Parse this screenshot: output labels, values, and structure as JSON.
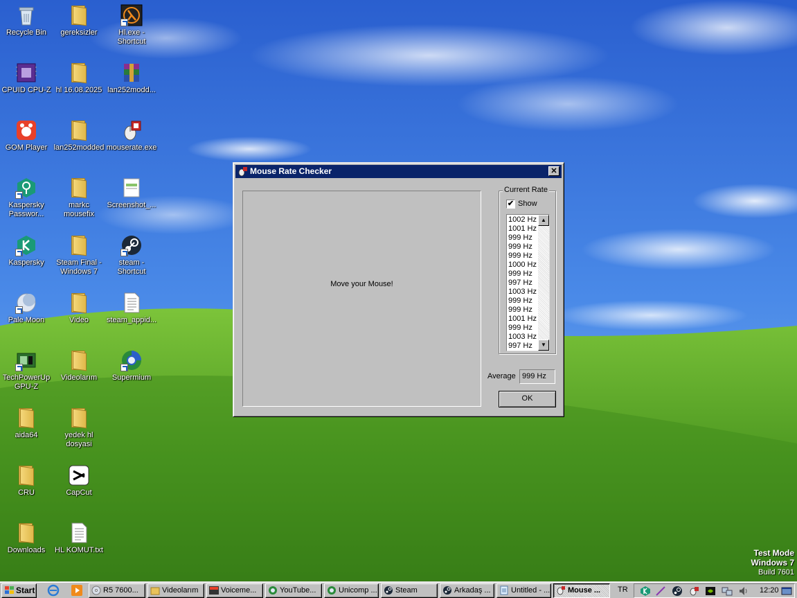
{
  "desktop": {
    "icons": [
      {
        "label": "Recycle Bin",
        "kind": "recycle-bin"
      },
      {
        "label": "gereksizler",
        "kind": "folder"
      },
      {
        "label": "Hl.exe - Shortcut",
        "kind": "half-life-shortcut"
      },
      {
        "label": "CPUID CPU-Z",
        "kind": "cpuz"
      },
      {
        "label": "hl 16.08.2025",
        "kind": "folder"
      },
      {
        "label": "lan252modd...",
        "kind": "winrar-archive"
      },
      {
        "label": "GOM Player",
        "kind": "gom-player"
      },
      {
        "label": "lan252modded",
        "kind": "folder"
      },
      {
        "label": "mouserate.exe",
        "kind": "mouserate"
      },
      {
        "label": "Kaspersky Passwor...",
        "kind": "kaspersky-password-shortcut"
      },
      {
        "label": "markc mousefix",
        "kind": "folder"
      },
      {
        "label": "Screenshot_...",
        "kind": "image-file"
      },
      {
        "label": "Kaspersky",
        "kind": "kaspersky-shortcut"
      },
      {
        "label": "Steam Final - Windows 7",
        "kind": "folder"
      },
      {
        "label": "steam - Shortcut",
        "kind": "steam-shortcut"
      },
      {
        "label": "Pale Moon",
        "kind": "pale-moon-shortcut"
      },
      {
        "label": "Video",
        "kind": "folder"
      },
      {
        "label": "steam_appid...",
        "kind": "text-file"
      },
      {
        "label": "TechPowerUp GPU-Z",
        "kind": "gpuz-shortcut"
      },
      {
        "label": "Videolarım",
        "kind": "folder"
      },
      {
        "label": "Supermium",
        "kind": "supermium-shortcut"
      },
      {
        "label": "aida64",
        "kind": "folder"
      },
      {
        "label": "yedek hl dosyasi",
        "kind": "folder"
      },
      {
        "label": "CRU",
        "kind": "folder"
      },
      {
        "label": "CapCut",
        "kind": "capcut"
      },
      {
        "label": "Downloads",
        "kind": "folder"
      },
      {
        "label": "HL KOMUT.txt",
        "kind": "text-file"
      }
    ]
  },
  "dialog": {
    "title": "Mouse Rate Checker",
    "close_label": "✕",
    "prompt": "Move your Mouse!",
    "current_rate_label": "Current Rate",
    "show_label": "Show",
    "show_checked": true,
    "rates": [
      "1002 Hz",
      "1001 Hz",
      "999 Hz",
      "999 Hz",
      "999 Hz",
      "1000 Hz",
      "999 Hz",
      "997 Hz",
      "1003 Hz",
      "999 Hz",
      "999 Hz",
      "1001 Hz",
      "999 Hz",
      "1003 Hz",
      "997 Hz"
    ],
    "average_label": "Average",
    "average_value": "999 Hz",
    "ok_label": "OK"
  },
  "watermark": {
    "line1": "Test Mode",
    "line2": "Windows 7",
    "line3": "Build 7601"
  },
  "taskbar": {
    "start_label": "Start",
    "tasks": [
      {
        "label": "R5 7600...",
        "icon": "disc-icon"
      },
      {
        "label": "Videolarım",
        "icon": "folder-icon"
      },
      {
        "label": "Voiceme...",
        "icon": "voicemeeter-icon"
      },
      {
        "label": "YouTube...",
        "icon": "browser-icon"
      },
      {
        "label": "Unicomp ...",
        "icon": "browser-icon"
      },
      {
        "label": "Steam",
        "icon": "steam-icon"
      },
      {
        "label": "Arkadaş ...",
        "icon": "steam-icon"
      },
      {
        "label": "Untitled - ...",
        "icon": "notepad-icon"
      },
      {
        "label": "Mouse ...",
        "icon": "mouserate-icon",
        "active": true
      }
    ],
    "language": "TR",
    "clock": "12:20"
  },
  "colors": {
    "titlebar": "#0a246a",
    "dialog_face": "#c0c0c0",
    "sky": "#2f6fd8",
    "grass": "#4f9a22"
  }
}
